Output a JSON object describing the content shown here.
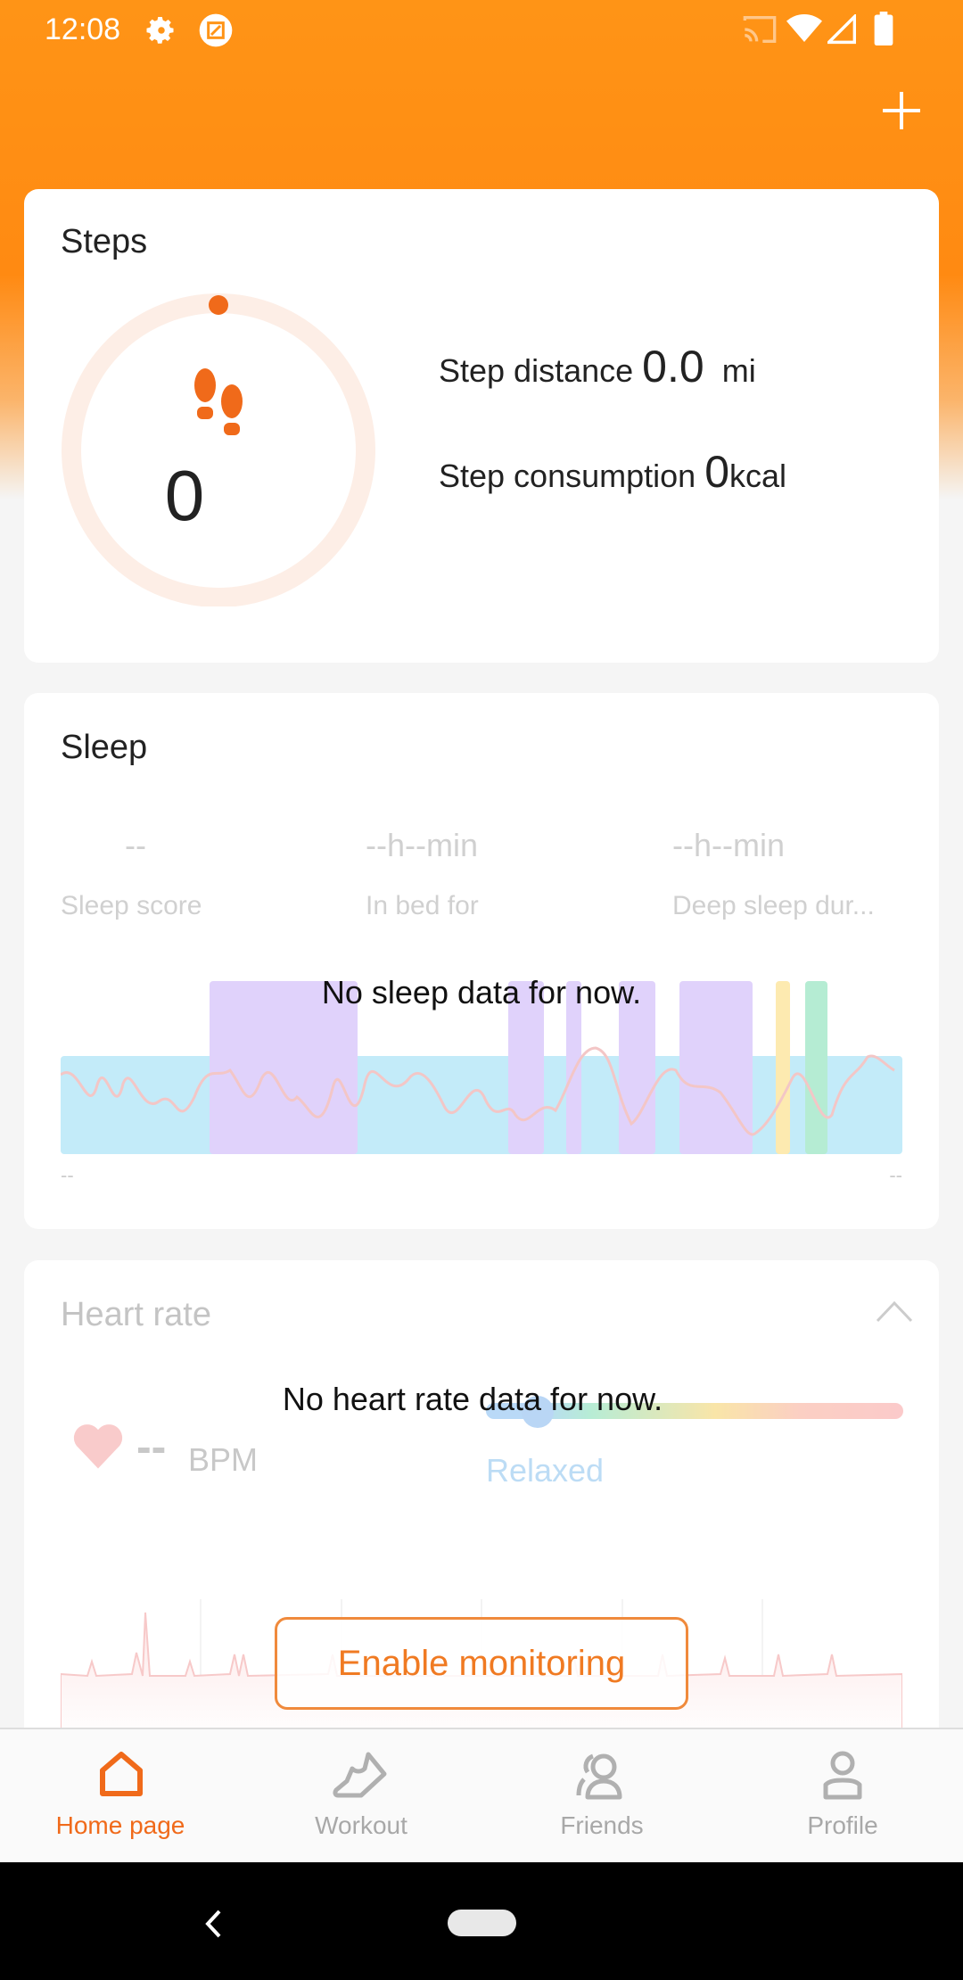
{
  "status_bar": {
    "time": "12:08",
    "icons": [
      "gear-icon",
      "screenshot-icon",
      "cast-icon",
      "wifi-icon",
      "signal-icon",
      "battery-icon"
    ]
  },
  "header": {
    "add_icon": "plus-icon"
  },
  "steps": {
    "title": "Steps",
    "count": "0",
    "progress": 0,
    "distance_label": "Step distance",
    "distance_value": "0.0",
    "distance_unit": "mi",
    "consumption_label": "Step consumption",
    "consumption_value": "0",
    "consumption_unit": "kcal"
  },
  "sleep": {
    "title": "Sleep",
    "stats": [
      {
        "value": "--",
        "label": "Sleep score"
      },
      {
        "value": "--h--min",
        "label": "In bed for"
      },
      {
        "value": "--h--min",
        "label": "Deep sleep dur..."
      }
    ],
    "empty_message": "No sleep data for now.",
    "start_label": "--",
    "end_label": "--"
  },
  "heart_rate": {
    "title": "Heart rate",
    "bpm_value": "--",
    "bpm_unit": "BPM",
    "zone": "Relaxed",
    "empty_message": "No heart rate data for now.",
    "enable_button": "Enable monitoring"
  },
  "bottom_nav": [
    {
      "label": "Home page",
      "icon": "home-icon",
      "active": true
    },
    {
      "label": "Workout",
      "icon": "shoe-icon",
      "active": false
    },
    {
      "label": "Friends",
      "icon": "friends-icon",
      "active": false
    },
    {
      "label": "Profile",
      "icon": "profile-icon",
      "active": false
    }
  ],
  "colors": {
    "accent": "#f06a1a",
    "header": "#ff8c14",
    "light_sleep": "#c3ebf9",
    "deep_sleep": "#e0d2fb",
    "awake": "#fdeab0",
    "rem": "#b5ecd3"
  }
}
